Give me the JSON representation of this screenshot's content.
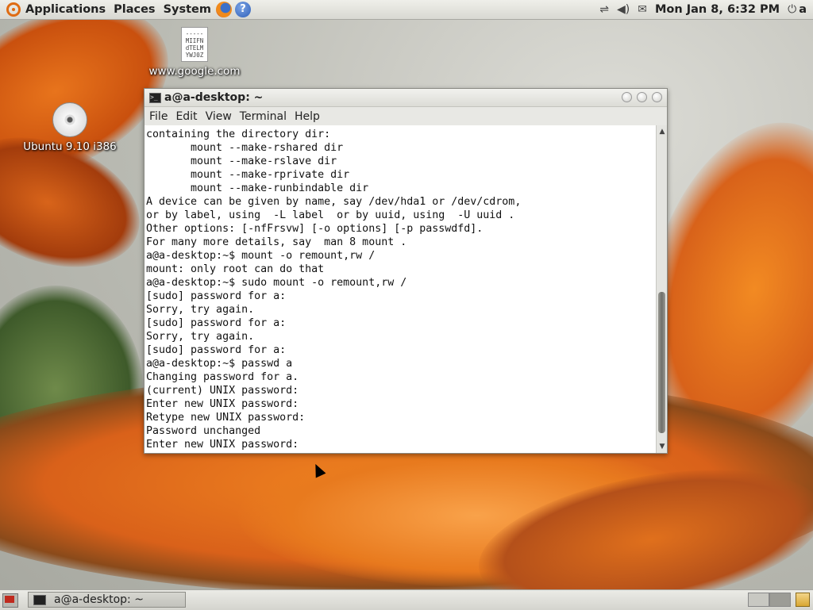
{
  "top_panel": {
    "menus": [
      "Applications",
      "Places",
      "System"
    ],
    "clock": "Mon Jan  8,  6:32 PM",
    "user": "a"
  },
  "desktop_icons": [
    {
      "label": "www.google.com",
      "file_preview": "-----\nMIIFN\ndTELM\nYWJ0Z"
    },
    {
      "label": "Ubuntu 9.10 i386"
    }
  ],
  "window": {
    "title": "a@a-desktop: ~",
    "menu": [
      "File",
      "Edit",
      "View",
      "Terminal",
      "Help"
    ],
    "terminal_lines": [
      "containing the directory dir:",
      "       mount --make-rshared dir",
      "       mount --make-rslave dir",
      "       mount --make-rprivate dir",
      "       mount --make-runbindable dir",
      "A device can be given by name, say /dev/hda1 or /dev/cdrom,",
      "or by label, using  -L label  or by uuid, using  -U uuid .",
      "Other options: [-nfFrsvw] [-o options] [-p passwdfd].",
      "For many more details, say  man 8 mount .",
      "a@a-desktop:~$ mount -o remount,rw /",
      "mount: only root can do that",
      "a@a-desktop:~$ sudo mount -o remount,rw /",
      "[sudo] password for a:",
      "Sorry, try again.",
      "[sudo] password for a:",
      "Sorry, try again.",
      "[sudo] password for a:",
      "a@a-desktop:~$ passwd a",
      "Changing password for a.",
      "(current) UNIX password:",
      "Enter new UNIX password:",
      "Retype new UNIX password:",
      "Password unchanged",
      "Enter new UNIX password:"
    ]
  },
  "taskbar": {
    "task_label": "a@a-desktop: ~"
  },
  "colors": {
    "accent": "#df6b12",
    "panel": "#e2e2dc",
    "terminal_bg": "#ffffff"
  }
}
